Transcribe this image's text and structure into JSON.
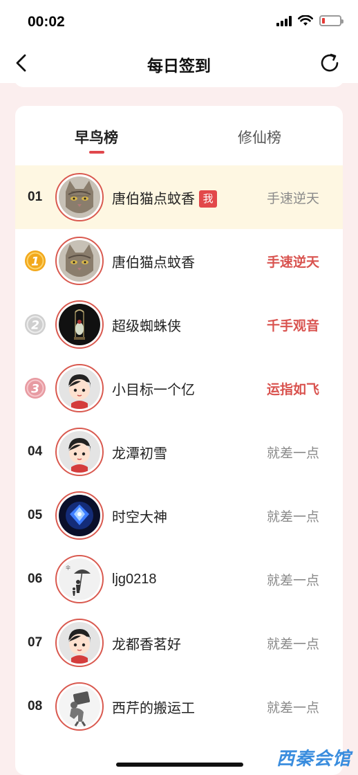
{
  "status_bar": {
    "time": "00:02"
  },
  "nav": {
    "title": "每日签到",
    "back_icon": "chevron-left-icon",
    "refresh_icon": "refresh-icon"
  },
  "tabs": [
    {
      "label": "早鸟榜",
      "active": true
    },
    {
      "label": "修仙榜",
      "active": false
    }
  ],
  "colors": {
    "accent": "#e0474c",
    "self_row_bg": "#fef7e2",
    "gold": "#f2a81b",
    "silver": "#c8c8c8",
    "bronze": "#e79aa1"
  },
  "self_entry": {
    "rank": "01",
    "name": "唐伯猫点蚊香",
    "me_badge": "我",
    "status": "手速逆天",
    "avatar": "cat-avatar"
  },
  "rankings": [
    {
      "rank": "1",
      "medal": "gold-medal-icon",
      "name": "唐伯猫点蚊香",
      "status": "手速逆天",
      "highlight": true,
      "avatar": "cat-avatar"
    },
    {
      "rank": "2",
      "medal": "silver-medal-icon",
      "name": "超级蜘蛛侠",
      "status": "千手观音",
      "highlight": true,
      "avatar": "jade-ornament-avatar"
    },
    {
      "rank": "3",
      "medal": "bronze-medal-icon",
      "name": "小目标一个亿",
      "status": "运指如飞",
      "highlight": true,
      "avatar": "cartoon-kid-avatar"
    },
    {
      "rank": "04",
      "name": "龙潭初雪",
      "status": "就差一点",
      "highlight": false,
      "avatar": "cartoon-kid-avatar"
    },
    {
      "rank": "05",
      "name": "时空大神",
      "status": "就差一点",
      "highlight": false,
      "avatar": "blue-crystal-avatar"
    },
    {
      "rank": "06",
      "name": "ljg0218",
      "status": "就差一点",
      "highlight": false,
      "avatar": "umbrella-sketch-avatar"
    },
    {
      "rank": "07",
      "name": "龙都香茗好",
      "status": "就差一点",
      "highlight": false,
      "avatar": "cartoon-kid-avatar"
    },
    {
      "rank": "08",
      "name": "西芹的搬运工",
      "status": "就差一点",
      "highlight": false,
      "avatar": "porter-figure-avatar"
    }
  ],
  "watermark": "西秦会馆"
}
